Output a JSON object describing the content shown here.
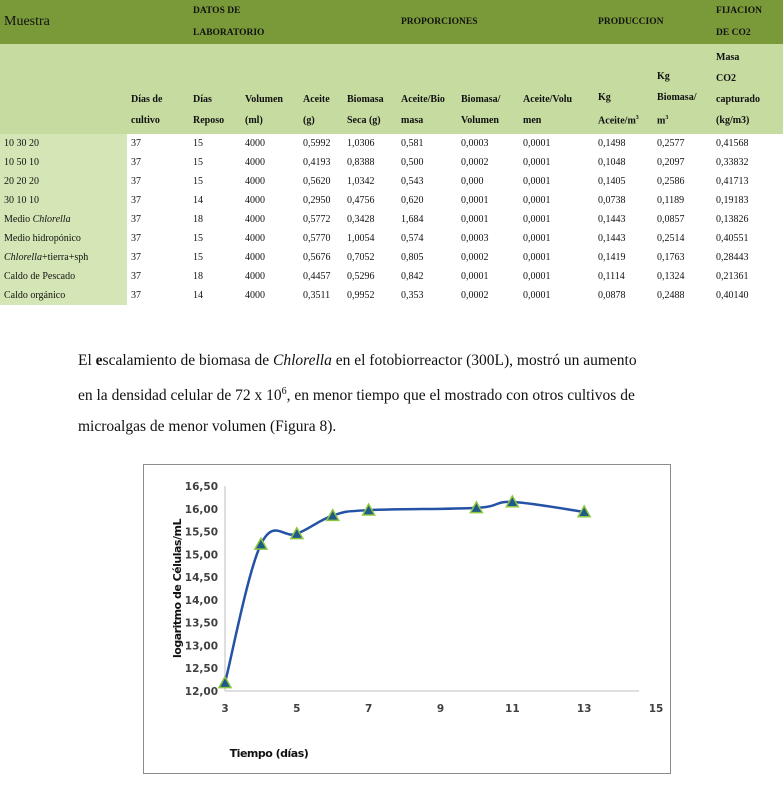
{
  "table": {
    "group_headers": {
      "muestra": "Muestra",
      "datos_lab_1": "DATOS DE",
      "datos_lab_2": "LABORATORIO",
      "proporciones": "PROPORCIONES",
      "produccion": "PRODUCCION",
      "fijacion_1": "FIJACION",
      "fijacion_2": "DE CO2"
    },
    "columns": [
      {
        "line1": "Días de",
        "line2": "cultivo"
      },
      {
        "line1": "Días",
        "line2": "Reposo"
      },
      {
        "line1": "Volumen",
        "line2": "(ml)"
      },
      {
        "line1": "Aceite",
        "line2": "(g)"
      },
      {
        "line1": "Biomasa",
        "line2": "Seca (g)"
      },
      {
        "line1": "Aceite/Bio",
        "line2": "masa"
      },
      {
        "line1": "Biomasa/",
        "line2": "Volumen"
      },
      {
        "line1": "Aceite/Volu",
        "line2": "men"
      },
      {
        "line1": "Kg",
        "line2": "Aceite/m",
        "sup": "3"
      },
      {
        "line0": "Kg",
        "line1": "Biomasa/",
        "line2": "m",
        "sup": "3"
      },
      {
        "line_a": "Masa",
        "line0": "CO2",
        "line1": "capturado",
        "line2": "(kg/m3)"
      }
    ],
    "rows": [
      {
        "label": "10 30 20",
        "italic": "",
        "suffix": "",
        "values": [
          "37",
          "15",
          "4000",
          "0,5992",
          "1,0306",
          "0,581",
          "0,0003",
          "0,0001",
          "0,1498",
          "0,2577",
          "0,41568"
        ]
      },
      {
        "label": "10 50 10",
        "italic": "",
        "suffix": "",
        "values": [
          "37",
          "15",
          "4000",
          "0,4193",
          "0,8388",
          "0,500",
          "0,0002",
          "0,0001",
          "0,1048",
          "0,2097",
          "0,33832"
        ]
      },
      {
        "label": "20 20 20",
        "italic": "",
        "suffix": "",
        "values": [
          "37",
          "15",
          "4000",
          "0,5620",
          "1,0342",
          "0,543",
          "0,000",
          "0,0001",
          "0,1405",
          "0,2586",
          "0,41713"
        ]
      },
      {
        "label": "30 10 10",
        "italic": "",
        "suffix": "",
        "values": [
          "37",
          "14",
          "4000",
          "0,2950",
          "0,4756",
          "0,620",
          "0,0001",
          "0,0001",
          "0,0738",
          "0,1189",
          "0,19183"
        ]
      },
      {
        "label": "Medio ",
        "italic": "Chlorella",
        "suffix": "",
        "values": [
          "37",
          "18",
          "4000",
          "0,5772",
          "0,3428",
          "1,684",
          "0,0001",
          "0,0001",
          "0,1443",
          "0,0857",
          "0,13826"
        ]
      },
      {
        "label": "Medio hidropónico",
        "italic": "",
        "suffix": "",
        "values": [
          "37",
          "15",
          "4000",
          "0,5770",
          "1,0054",
          "0,574",
          "0,0003",
          "0,0001",
          "0,1443",
          "0,2514",
          "0,40551"
        ]
      },
      {
        "label": "",
        "italic": "Chlorella",
        "suffix": "+tierra+sph",
        "values": [
          "37",
          "15",
          "4000",
          "0,5676",
          "0,7052",
          "0,805",
          "0,0002",
          "0,0001",
          "0,1419",
          "0,1763",
          "0,28443"
        ]
      },
      {
        "label": "Caldo de Pescado",
        "italic": "",
        "suffix": "",
        "values": [
          "37",
          "18",
          "4000",
          "0,4457",
          "0,5296",
          "0,842",
          "0,0001",
          "0,0001",
          "0,1114",
          "0,1324",
          "0,21361"
        ]
      },
      {
        "label": "Caldo orgánico",
        "italic": "",
        "suffix": "",
        "values": [
          "37",
          "14",
          "4000",
          "0,3511",
          "0,9952",
          "0,353",
          "0,0002",
          "0,0001",
          "0,0878",
          "0,2488",
          "0,40140"
        ]
      }
    ]
  },
  "paragraph": {
    "p1a": "El ",
    "p1b": "e",
    "p1c": "scalamiento de biomasa de ",
    "p1d": "Chlorella",
    "p1e": " en el fotobiorreactor (300L), mostró un aumento",
    "p2a": "en la  densidad celular de 72 x 10",
    "p2sup": "6",
    "p2b": ", en menor tiempo que el mostrado con otros cultivos de",
    "p3": "microalgas de menor volumen (Figura 8)."
  },
  "chart_data": {
    "type": "line",
    "title": "",
    "xlabel": "Tiempo (días)",
    "ylabel": "logaritmo  de Células/mL",
    "xlim": [
      3,
      15
    ],
    "ylim": [
      12.0,
      16.5
    ],
    "xticks": [
      3,
      5,
      7,
      9,
      11,
      13,
      15
    ],
    "xtick_labels": [
      "3",
      "5",
      "7",
      "9",
      "11",
      "13",
      "15"
    ],
    "yticks": [
      12.0,
      12.5,
      13.0,
      13.5,
      14.0,
      14.5,
      15.0,
      15.5,
      16.0,
      16.5
    ],
    "ytick_labels": [
      "12,00",
      "12,50",
      "13,00",
      "13,50",
      "14,00",
      "14,50",
      "15,00",
      "15,50",
      "16,00",
      "16,50"
    ],
    "grid": false,
    "legend": "none",
    "series": [
      {
        "name": "logaritmo de Células/mL",
        "x": [
          3,
          4,
          5,
          6,
          7,
          10,
          11,
          13
        ],
        "y": [
          12.18,
          15.22,
          15.45,
          15.85,
          15.97,
          16.02,
          16.15,
          15.93
        ],
        "line_color": "#2452a4",
        "marker": "triangle",
        "marker_fill": "#1f5a8a",
        "marker_edge": "#8cc63e"
      }
    ]
  }
}
